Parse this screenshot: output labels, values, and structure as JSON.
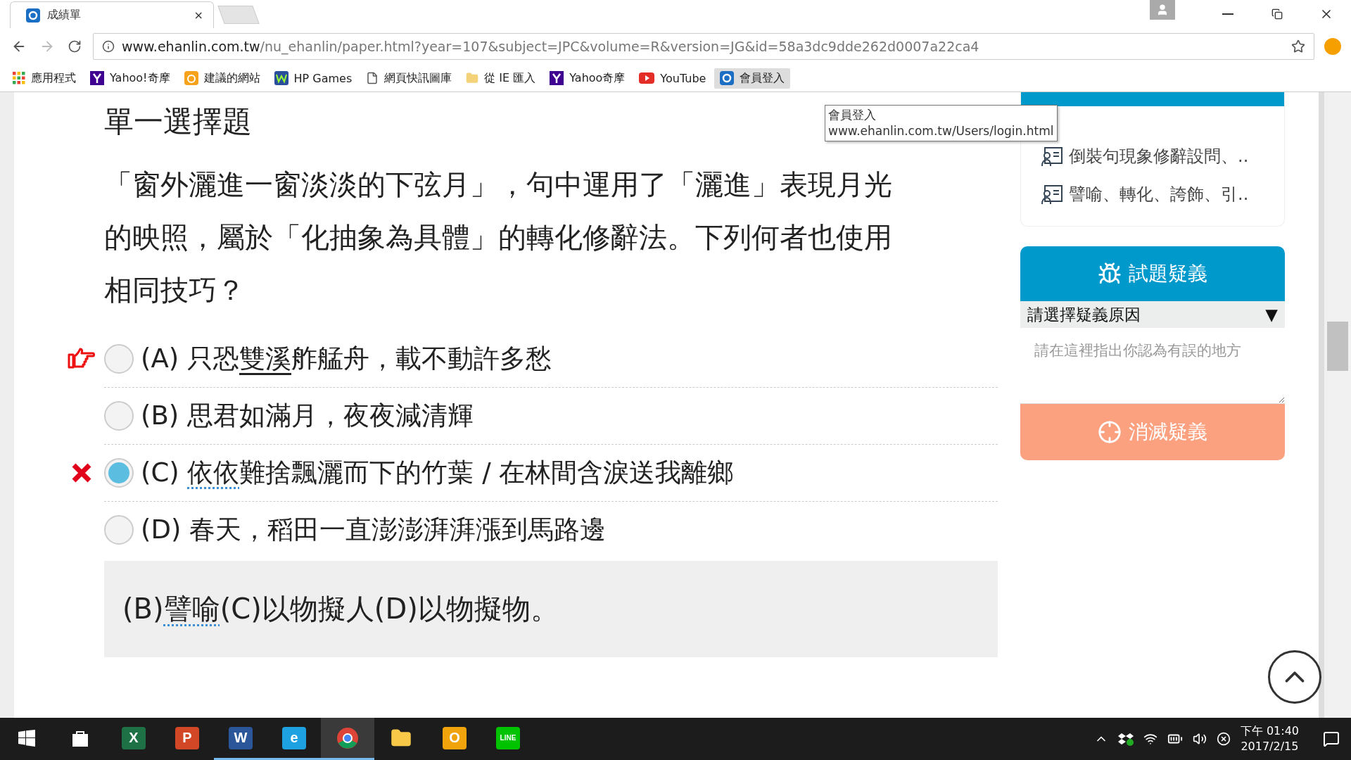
{
  "browser": {
    "tab": {
      "title": "成績單",
      "close": "×"
    },
    "url": {
      "host": "www.ehanlin.com.tw",
      "path": "/nu_ehanlin/paper.html?year=107&subject=JPC&volume=R&version=JG&id=58a3dc9dde262d0007a22ca4"
    },
    "bookmarks": [
      {
        "kind": "apps",
        "label": "應用程式",
        "selected": false
      },
      {
        "kind": "yahoo",
        "label": "Yahoo!奇摩",
        "selected": false
      },
      {
        "kind": "suggest",
        "label": "建議的網站",
        "selected": false
      },
      {
        "kind": "hp",
        "label": "HP Games",
        "selected": false
      },
      {
        "kind": "page",
        "label": "網頁快訊圖庫",
        "selected": false
      },
      {
        "kind": "folder",
        "label": "從 IE 匯入",
        "selected": false
      },
      {
        "kind": "yahoo",
        "label": "Yahoo奇摩",
        "selected": false
      },
      {
        "kind": "youtube",
        "label": "YouTube",
        "selected": false
      },
      {
        "kind": "site",
        "label": "會員登入",
        "selected": true
      }
    ],
    "tooltip": {
      "title": "會員登入",
      "url": "www.ehanlin.com.tw/Users/login.html"
    }
  },
  "question": {
    "heading": "單一選擇題",
    "text": "「窗外灑進一窗淡淡的下弦月」，句中運用了「灑進」表現月光的映照，屬於「化抽象為具體」的轉化修辭法。下列何者也使用相同技巧？",
    "options": [
      {
        "letter": "(A)",
        "selected": false,
        "kind": "correct",
        "parts": [
          {
            "text": "只恐",
            "kind": "plain"
          },
          {
            "text": "雙溪",
            "kind": "underline"
          },
          {
            "text": "舴艋舟，載不動許多愁",
            "kind": "plain"
          }
        ]
      },
      {
        "letter": "(B)",
        "selected": false,
        "kind": "plain",
        "parts": [
          {
            "text": "思君如滿月，夜夜減清輝",
            "kind": "plain"
          }
        ]
      },
      {
        "letter": "(C)",
        "selected": true,
        "kind": "wrong",
        "parts": [
          {
            "text": "依依",
            "kind": "dotted"
          },
          {
            "text": "難捨飄灑而下的竹葉 / 在林間含淚送我離鄉",
            "kind": "plain"
          }
        ]
      },
      {
        "letter": "(D)",
        "selected": false,
        "kind": "plain",
        "parts": [
          {
            "text": "春天，稻田一直澎澎湃湃漲到馬路邊",
            "kind": "plain"
          }
        ]
      }
    ],
    "explanation": [
      {
        "text": "(B)",
        "kind": "plain"
      },
      {
        "text": "譬喻",
        "kind": "dotted"
      },
      {
        "text": "(C)以物擬人(D)以物擬物。",
        "kind": "plain"
      }
    ]
  },
  "sidebar": {
    "topics": [
      "倒裝句現象修辭設問、..",
      "譬喻、轉化、誇飾、引.."
    ],
    "report": {
      "title": "試題疑義",
      "select": "請選擇疑義原因",
      "select_caret": "▼",
      "placeholder": "請在這裡指出你認為有誤的地方",
      "button": "消滅疑義"
    }
  },
  "taskbar": {
    "apps": [
      {
        "kind": "store",
        "selected": false,
        "running": false
      },
      {
        "kind": "excel",
        "label": "X",
        "selected": false,
        "running": false
      },
      {
        "kind": "powerpoint",
        "label": "P",
        "selected": false,
        "running": false
      },
      {
        "kind": "word",
        "label": "W",
        "selected": false,
        "running": true
      },
      {
        "kind": "ie",
        "label": "e",
        "selected": false,
        "running": true
      },
      {
        "kind": "chrome",
        "selected": true,
        "running": true
      },
      {
        "kind": "files",
        "selected": false,
        "running": false
      },
      {
        "kind": "outlook",
        "label": "O",
        "selected": false,
        "running": false
      },
      {
        "kind": "line",
        "label": "LINE",
        "selected": false,
        "running": false
      }
    ],
    "time": "下午 01:40",
    "date": "2017/2/15"
  }
}
